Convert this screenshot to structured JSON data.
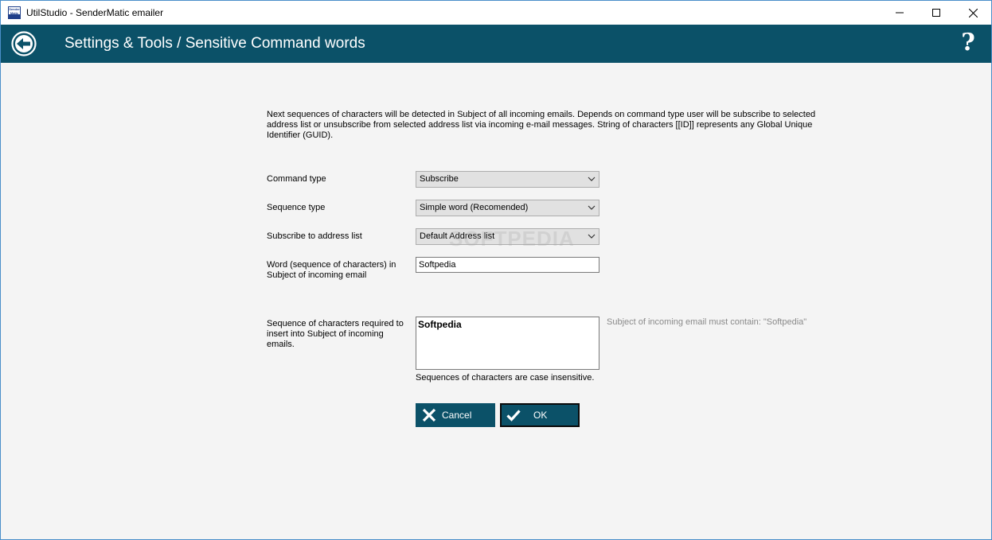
{
  "window": {
    "title": "UtilStudio - SenderMatic emailer",
    "app_icon_text": "Sender Matic"
  },
  "header": {
    "title": "Settings & Tools / Sensitive Command words",
    "help_symbol": "?"
  },
  "description": "Next sequences of characters will be detected in Subject of all incoming emails. Depends on command type user will be subscribe to selected address list or unsubscribe from selected address list via incoming e-mail messages. String of characters [[ID]] represents any Global Unique Identifier (GUID).",
  "form": {
    "command_type": {
      "label": "Command type",
      "value": "Subscribe"
    },
    "sequence_type": {
      "label": "Sequence type",
      "value": "Simple word (Recomended)"
    },
    "address_list": {
      "label": "Subscribe to address list",
      "value": "Default Address list"
    },
    "word": {
      "label": "Word (sequence of characters) in Subject of incoming email",
      "value": "Softpedia"
    },
    "sequence": {
      "label": "Sequence of characters required to insert into Subject of incoming emails.",
      "value": "Softpedia",
      "hint": "Subject of incoming email must contain: \"Softpedia\"",
      "note": "Sequences of characters are case insensitive."
    }
  },
  "buttons": {
    "cancel": "Cancel",
    "ok": "OK"
  },
  "watermark": "SOFTPEDIA",
  "colors": {
    "header_bg": "#0b5168",
    "button_bg": "#0b5168",
    "window_bg": "#f4f4f4"
  }
}
